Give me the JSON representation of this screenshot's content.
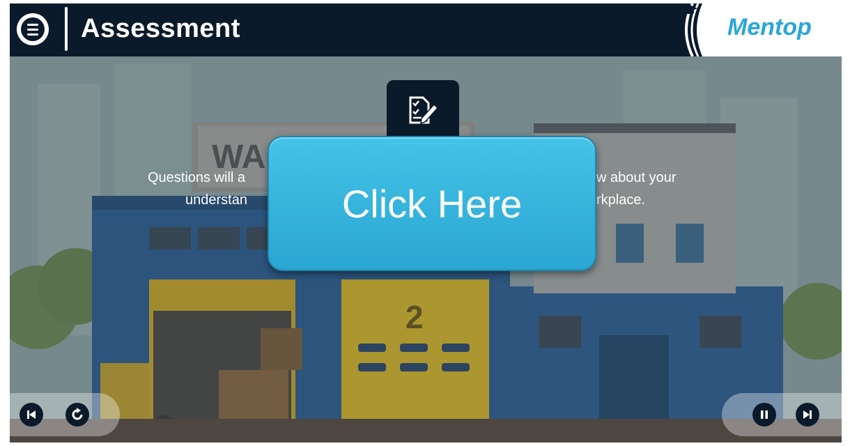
{
  "header": {
    "title": "Assessment",
    "logo_text": "Mentop"
  },
  "main": {
    "question_text_left_line1": "Questions will a",
    "question_text_left_line2": "understan",
    "question_text_right_line1": "w about your",
    "question_text_right_line2": "rkplace.",
    "click_here_label": "Click Here",
    "background_sign_text": "WA",
    "door_number": "2"
  },
  "controls": {
    "left": [
      "skip-back-icon",
      "replay-icon"
    ],
    "right": [
      "pause-icon",
      "skip-forward-icon"
    ]
  },
  "colors": {
    "header_bg": "#0b1a2b",
    "accent": "#2aa6d9",
    "button_bg": "#3bb8e0"
  }
}
